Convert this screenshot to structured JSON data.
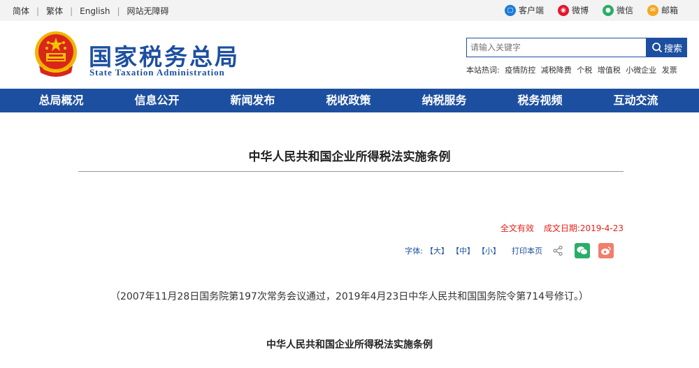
{
  "topbar": {
    "links": [
      "简体",
      "繁体",
      "English",
      "网站无障碍"
    ],
    "social": [
      {
        "label": "客户端",
        "icon": "app-icon",
        "color": "#1d7ad6"
      },
      {
        "label": "微博",
        "icon": "weibo-icon",
        "color": "#e6162d"
      },
      {
        "label": "微信",
        "icon": "wechat-icon",
        "color": "#2aae67"
      },
      {
        "label": "邮箱",
        "icon": "mail-icon",
        "color": "#f5a623"
      }
    ]
  },
  "header": {
    "title_cn": "国家税务总局",
    "title_en": "State Taxation Administration",
    "search": {
      "placeholder": "请输入关键字",
      "button": "搜索"
    },
    "hot_label": "本站热词:",
    "hot_words": [
      "疫情防控",
      "减税降费",
      "个税",
      "增值税",
      "小微企业",
      "发票"
    ]
  },
  "nav": [
    "总局概况",
    "信息公开",
    "新闻发布",
    "税收政策",
    "纳税服务",
    "税务视频",
    "互动交流"
  ],
  "article": {
    "title": "中华人民共和国企业所得税法实施条例",
    "validity": "全文有效",
    "date_label": "成文日期:",
    "date": "2019-4-23",
    "font_label": "字体:",
    "font_large": "【大】",
    "font_medium": "【中】",
    "font_small": "【小】",
    "print_label": "打印本页",
    "note": "（2007年11月28日国务院第197次常务会议通过，2019年4月23日中华人民共和国国务院令第714号修订。）",
    "sub_title": "中华人民共和国企业所得税法实施条例"
  },
  "colors": {
    "brand": "#1d4fa0",
    "accent": "#e8201a"
  }
}
